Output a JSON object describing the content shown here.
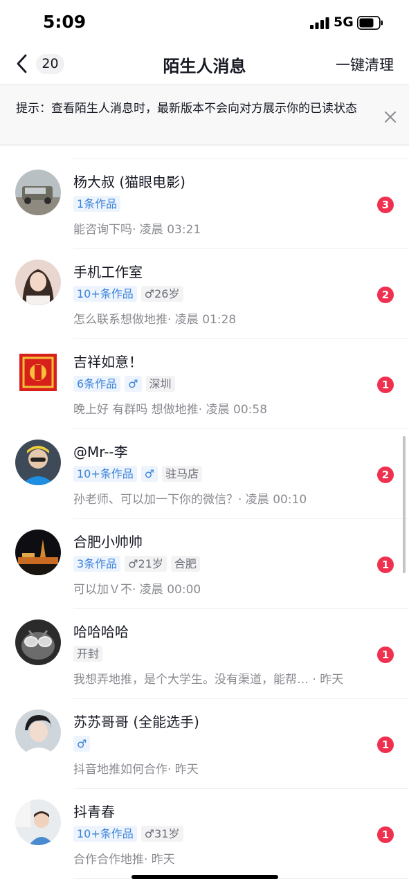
{
  "status_bar": {
    "time": "5:09",
    "network": "5G"
  },
  "nav": {
    "unread_count": "20",
    "title": "陌生人消息",
    "clear_all": "一键清理"
  },
  "notice": {
    "text": "提示：查看陌生人消息时，最新版本不会向对方展示你的已读状态"
  },
  "messages": [
    {
      "name": "杨大叔 (猫眼电影)",
      "tags": [
        "1条作品"
      ],
      "preview": "能咨询下吗· 凌晨 03:21",
      "badge": "3"
    },
    {
      "name": "手机工作室",
      "tags": [
        "10+条作品",
        "♂26岁"
      ],
      "preview": "怎么联系想做地推· 凌晨 01:28",
      "badge": "2"
    },
    {
      "name": "吉祥如意！",
      "tags": [
        "6条作品",
        "♂",
        "深圳"
      ],
      "preview": "晚上好 有群吗 想做地推· 凌晨 00:58",
      "badge": "1"
    },
    {
      "name": "@Mr--李",
      "tags": [
        "10+条作品",
        "♂",
        "驻马店"
      ],
      "preview": "孙老师、可以加一下你的微信？· 凌晨 00:10",
      "badge": "2"
    },
    {
      "name": "合肥小帅帅",
      "tags": [
        "3条作品",
        "♂21岁",
        "合肥"
      ],
      "preview": "可以加Ｖ不· 凌晨 00:00",
      "badge": "1"
    },
    {
      "name": "哈哈哈哈",
      "tags": [
        "开封"
      ],
      "preview": "我想弄地推，是个大学生。没有渠道，能帮… · 昨天",
      "badge": "1"
    },
    {
      "name": "苏苏哥哥 (全能选手)",
      "tags": [
        "♂"
      ],
      "preview": "抖音地推如何合作· 昨天",
      "badge": "1"
    },
    {
      "name": "抖青春",
      "tags": [
        "10+条作品",
        "♂31岁"
      ],
      "preview": "合作合作地推· 昨天",
      "badge": "1"
    }
  ],
  "colors": {
    "badge": "#f0304f",
    "tag_blue": "#3a82d8"
  }
}
